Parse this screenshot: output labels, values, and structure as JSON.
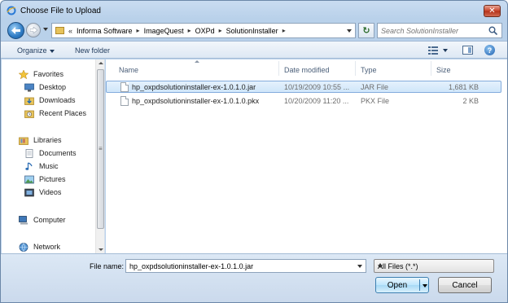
{
  "window": {
    "title": "Choose File to Upload"
  },
  "address": {
    "overflow": "«",
    "crumbs": [
      "Informa Software",
      "ImageQuest",
      "OXPd",
      "SolutionInstaller"
    ]
  },
  "search": {
    "placeholder": "Search SolutionInstaller"
  },
  "toolbar": {
    "organize": "Organize",
    "new_folder": "New folder"
  },
  "nav": {
    "favorites": "Favorites",
    "desktop": "Desktop",
    "downloads": "Downloads",
    "recent_places": "Recent Places",
    "libraries": "Libraries",
    "documents": "Documents",
    "music": "Music",
    "pictures": "Pictures",
    "videos": "Videos",
    "computer": "Computer",
    "network": "Network"
  },
  "columns": {
    "name": "Name",
    "date": "Date modified",
    "type": "Type",
    "size": "Size"
  },
  "files": [
    {
      "name": "hp_oxpdsolutioninstaller-ex-1.0.1.0.jar",
      "date": "10/19/2009 10:55 ...",
      "type": "JAR File",
      "size": "1,681 KB",
      "selected": true
    },
    {
      "name": "hp_oxpdsolutioninstaller-ex-1.0.1.0.pkx",
      "date": "10/20/2009 11:20 ...",
      "type": "PKX File",
      "size": "2 KB",
      "selected": false
    }
  ],
  "bottom": {
    "file_name_label": "File name:",
    "file_name_value": "hp_oxpdsolutioninstaller-ex-1.0.1.0.jar",
    "file_type": "All Files (*.*)",
    "open": "Open",
    "cancel": "Cancel"
  },
  "colors": {
    "accent": "#3c7fb1",
    "selection": "#cfe6fa",
    "close": "#c7432a"
  }
}
